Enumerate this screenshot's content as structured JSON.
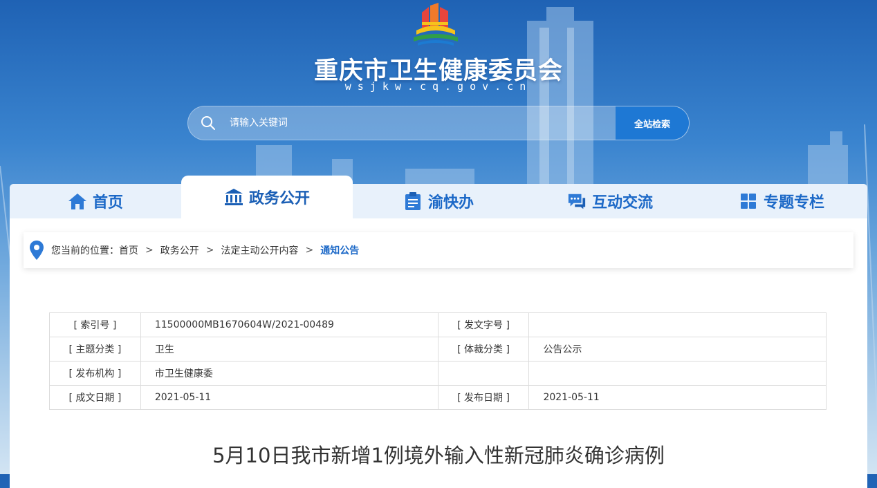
{
  "header": {
    "site_title": "重庆市卫生健康委员会",
    "site_domain": "wsjkw.cq.gov.cn",
    "logo_icon": "chongqing-government-logo"
  },
  "search": {
    "placeholder": "请输入关键词",
    "button_label": "全站检索",
    "icon": "search-icon"
  },
  "nav": {
    "items": [
      {
        "label": "首页",
        "icon": "home-icon",
        "active": false
      },
      {
        "label": "政务公开",
        "icon": "government-building-icon",
        "active": true
      },
      {
        "label": "渝快办",
        "icon": "clipboard-icon",
        "active": false
      },
      {
        "label": "互动交流",
        "icon": "chat-icon",
        "active": false
      },
      {
        "label": "专题专栏",
        "icon": "grid-icon",
        "active": false
      }
    ]
  },
  "breadcrumb": {
    "prefix": "您当前的位置：",
    "items": [
      "首页",
      "政务公开",
      "法定主动公开内容",
      "通知公告"
    ],
    "separator": ">"
  },
  "meta": {
    "rows": [
      {
        "l1": "[ 索引号 ]",
        "v1": "11500000MB1670604W/2021-00489",
        "l2": "[ 发文字号 ]",
        "v2": ""
      },
      {
        "l1": "[ 主题分类 ]",
        "v1": "卫生",
        "l2": "[ 体裁分类 ]",
        "v2": "公告公示"
      },
      {
        "l1": "[ 发布机构 ]",
        "v1": "市卫生健康委",
        "l2": "",
        "v2": ""
      },
      {
        "l1": "[ 成文日期 ]",
        "v1": "2021-05-11",
        "l2": "[ 发布日期 ]",
        "v2": "2021-05-11"
      }
    ]
  },
  "article": {
    "title": "5月10日我市新增1例境外输入性新冠肺炎确诊病例"
  },
  "colors": {
    "accent": "#1b68c7",
    "button": "#1e78d4"
  }
}
